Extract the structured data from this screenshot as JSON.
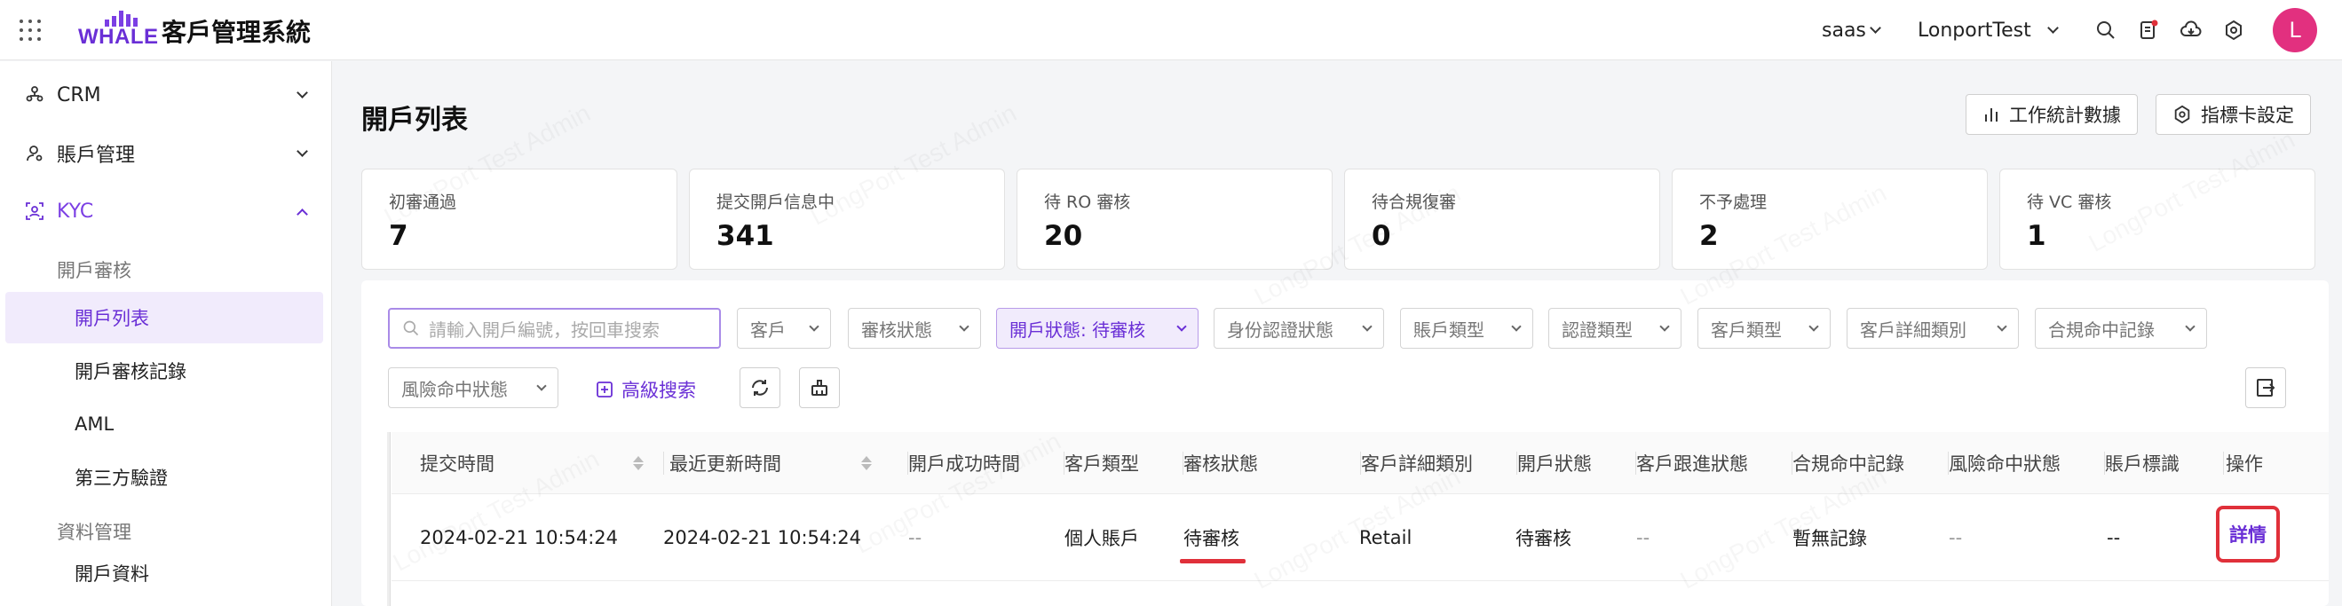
{
  "app": {
    "logo_text": "WHALE",
    "title": "客戶管理系統"
  },
  "topbar": {
    "env": "saas",
    "org": "LonportTest",
    "avatar_letter": "L"
  },
  "sidebar": {
    "items": [
      {
        "label": "CRM",
        "icon": "people-network-icon"
      },
      {
        "label": "賬戶管理",
        "icon": "user-icon"
      },
      {
        "label": "KYC",
        "icon": "scan-face-icon"
      }
    ],
    "groups": [
      "開戶審核",
      "資料管理"
    ],
    "subs": [
      "開戶列表",
      "開戶審核記錄",
      "AML",
      "第三方驗證",
      "開戶資料"
    ]
  },
  "page": {
    "title": "開戶列表",
    "btn_stats": "工作統計數據",
    "btn_card": "指標卡設定"
  },
  "stats": [
    {
      "label": "初審通過",
      "value": "7"
    },
    {
      "label": "提交開戶信息中",
      "value": "341"
    },
    {
      "label": "待 RO 審核",
      "value": "20"
    },
    {
      "label": "待合規復審",
      "value": "0"
    },
    {
      "label": "不予處理",
      "value": "2"
    },
    {
      "label": "待 VC 審核",
      "value": "1"
    }
  ],
  "filters": {
    "search_placeholder": "請輸入開戶編號，按回車搜索",
    "row1": [
      "客戶",
      "審核狀態",
      "開戶狀態: 待審核",
      "身份認證狀態",
      "賬戶類型",
      "認證類型",
      "客戶類型",
      "客戶詳細類別",
      "合規命中記錄"
    ],
    "row2": [
      "風險命中狀態"
    ],
    "advanced": "高級搜索"
  },
  "table": {
    "headers": [
      "提交時間",
      "最近更新時間",
      "開戶成功時間",
      "客戶類型",
      "審核狀態",
      "客戶詳細類別",
      "開戶狀態",
      "客戶跟進狀態",
      "合規命中記錄",
      "風險命中狀態",
      "賬戶標識",
      "操作"
    ],
    "rows": [
      [
        "2024-02-21 10:54:24",
        "2024-02-21 10:54:24",
        "--",
        "個人賬戶",
        "待審核",
        "Retail",
        "待審核",
        "--",
        "暫無記錄",
        "--",
        "--",
        "詳情"
      ]
    ]
  },
  "watermark": "LongPort Test Admin",
  "colors": {
    "accent": "#6a2fd6",
    "highlight": "#e0303a",
    "avatar": "#e2307f"
  }
}
